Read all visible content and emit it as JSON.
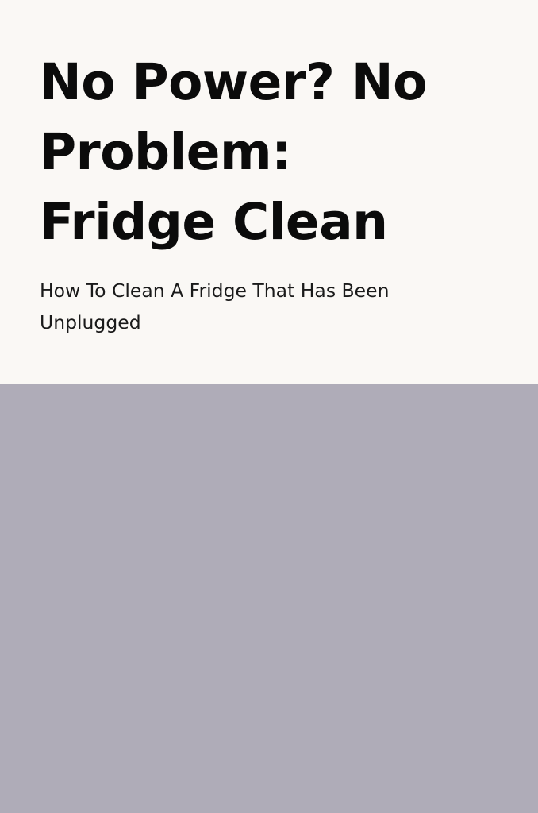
{
  "title_lines": [
    "No Power? No",
    "Problem:",
    "Fridge Clean"
  ],
  "subtitle_lines": [
    "How To Clean A Fridge That Has Been",
    "Unplugged"
  ],
  "colors": {
    "background": "#faf8f5",
    "title_text": "#0b0b0b",
    "subtitle_text": "#1a1a1a",
    "image_placeholder": "#afacb8"
  }
}
